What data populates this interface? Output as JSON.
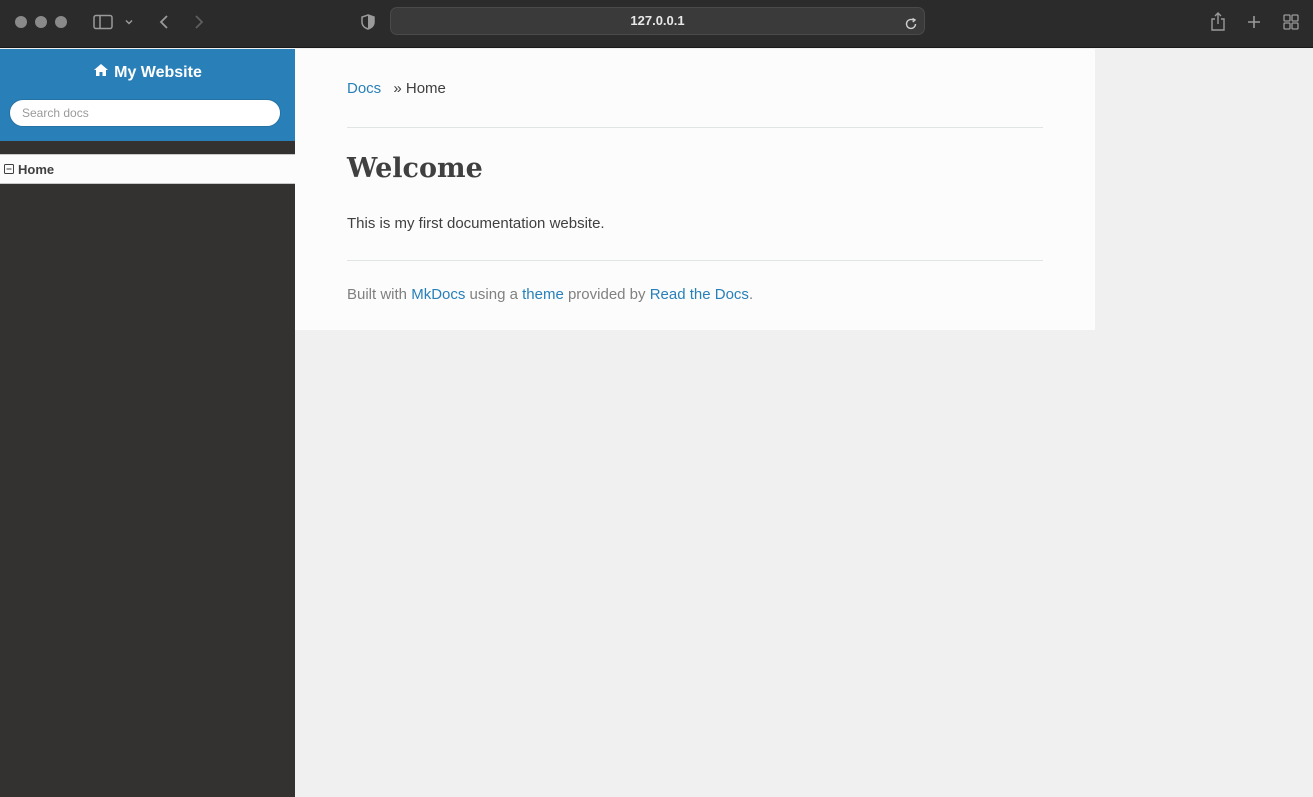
{
  "browser": {
    "url": "127.0.0.1"
  },
  "sidebar": {
    "brand": "My Website",
    "search_placeholder": "Search docs",
    "nav_items": [
      {
        "label": "Home",
        "current": true
      }
    ]
  },
  "breadcrumb": {
    "root": "Docs",
    "separator": "»",
    "current": "Home"
  },
  "main": {
    "title": "Welcome",
    "paragraph": "This is my first documentation website."
  },
  "footer": {
    "prefix": "Built with",
    "link1": "MkDocs",
    "mid1": "using a",
    "link2": "theme",
    "mid2": "provided by",
    "link3": "Read the Docs",
    "suffix": "."
  },
  "colors": {
    "accent": "#2980b9",
    "sidebar_bg": "#343131",
    "chrome_bg": "#2b2b2b"
  }
}
